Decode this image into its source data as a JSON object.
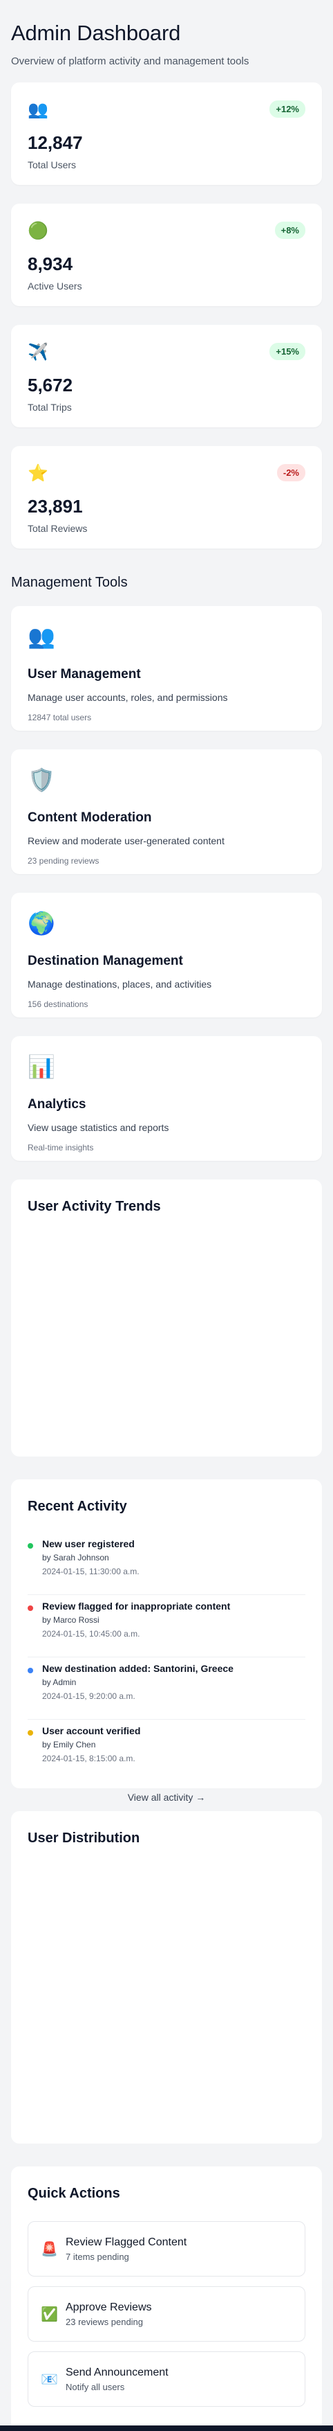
{
  "header": {
    "title": "Admin Dashboard",
    "subtitle": "Overview of platform activity and management tools"
  },
  "stats": [
    {
      "icon": "users-icon",
      "glyph": "👥",
      "value": "12,847",
      "label": "Total Users",
      "change": "+12%",
      "trend": "positive"
    },
    {
      "icon": "green-circle-icon",
      "glyph": "🟢",
      "value": "8,934",
      "label": "Active Users",
      "change": "+8%",
      "trend": "positive"
    },
    {
      "icon": "airplane-icon",
      "glyph": "✈️",
      "value": "5,672",
      "label": "Total Trips",
      "change": "+15%",
      "trend": "positive"
    },
    {
      "icon": "star-icon",
      "glyph": "⭐",
      "value": "23,891",
      "label": "Total Reviews",
      "change": "-2%",
      "trend": "negative"
    }
  ],
  "management": {
    "title": "Management Tools",
    "tools": [
      {
        "icon": "users-icon",
        "glyph": "👥",
        "title": "User Management",
        "description": "Manage user accounts, roles, and permissions",
        "meta": "12847 total users"
      },
      {
        "icon": "shield-icon",
        "glyph": "🛡️",
        "title": "Content Moderation",
        "description": "Review and moderate user-generated content",
        "meta": "23 pending reviews"
      },
      {
        "icon": "globe-icon",
        "glyph": "🌍",
        "title": "Destination Management",
        "description": "Manage destinations, places, and activities",
        "meta": "156 destinations"
      },
      {
        "icon": "bar-chart-icon",
        "glyph": "📊",
        "title": "Analytics",
        "description": "View usage statistics and reports",
        "meta": "Real-time insights"
      }
    ]
  },
  "activity_trends": {
    "title": "User Activity Trends"
  },
  "recent_activity": {
    "title": "Recent Activity",
    "items": [
      {
        "title": "New user registered",
        "by": "by Sarah Johnson",
        "time": "2024-01-15, 11:30:00 a.m.",
        "color": "#22c55e"
      },
      {
        "title": "Review flagged for inappropriate content",
        "by": "by Marco Rossi",
        "time": "2024-01-15, 10:45:00 a.m.",
        "color": "#ef4444"
      },
      {
        "title": "New destination added: Santorini, Greece",
        "by": "by Admin",
        "time": "2024-01-15, 9:20:00 a.m.",
        "color": "#3b82f6"
      },
      {
        "title": "User account verified",
        "by": "by Emily Chen",
        "time": "2024-01-15, 8:15:00 a.m.",
        "color": "#eab308"
      }
    ],
    "view_all": "View all activity →"
  },
  "user_distribution": {
    "title": "User Distribution"
  },
  "quick_actions": {
    "title": "Quick Actions",
    "items": [
      {
        "icon": "siren-icon",
        "glyph": "🚨",
        "title": "Review Flagged Content",
        "sub": "7 items pending"
      },
      {
        "icon": "check-icon",
        "glyph": "✅",
        "title": "Approve Reviews",
        "sub": "23 reviews pending"
      },
      {
        "icon": "email-icon",
        "glyph": "📧",
        "title": "Send Announcement",
        "sub": "Notify all users"
      }
    ]
  }
}
